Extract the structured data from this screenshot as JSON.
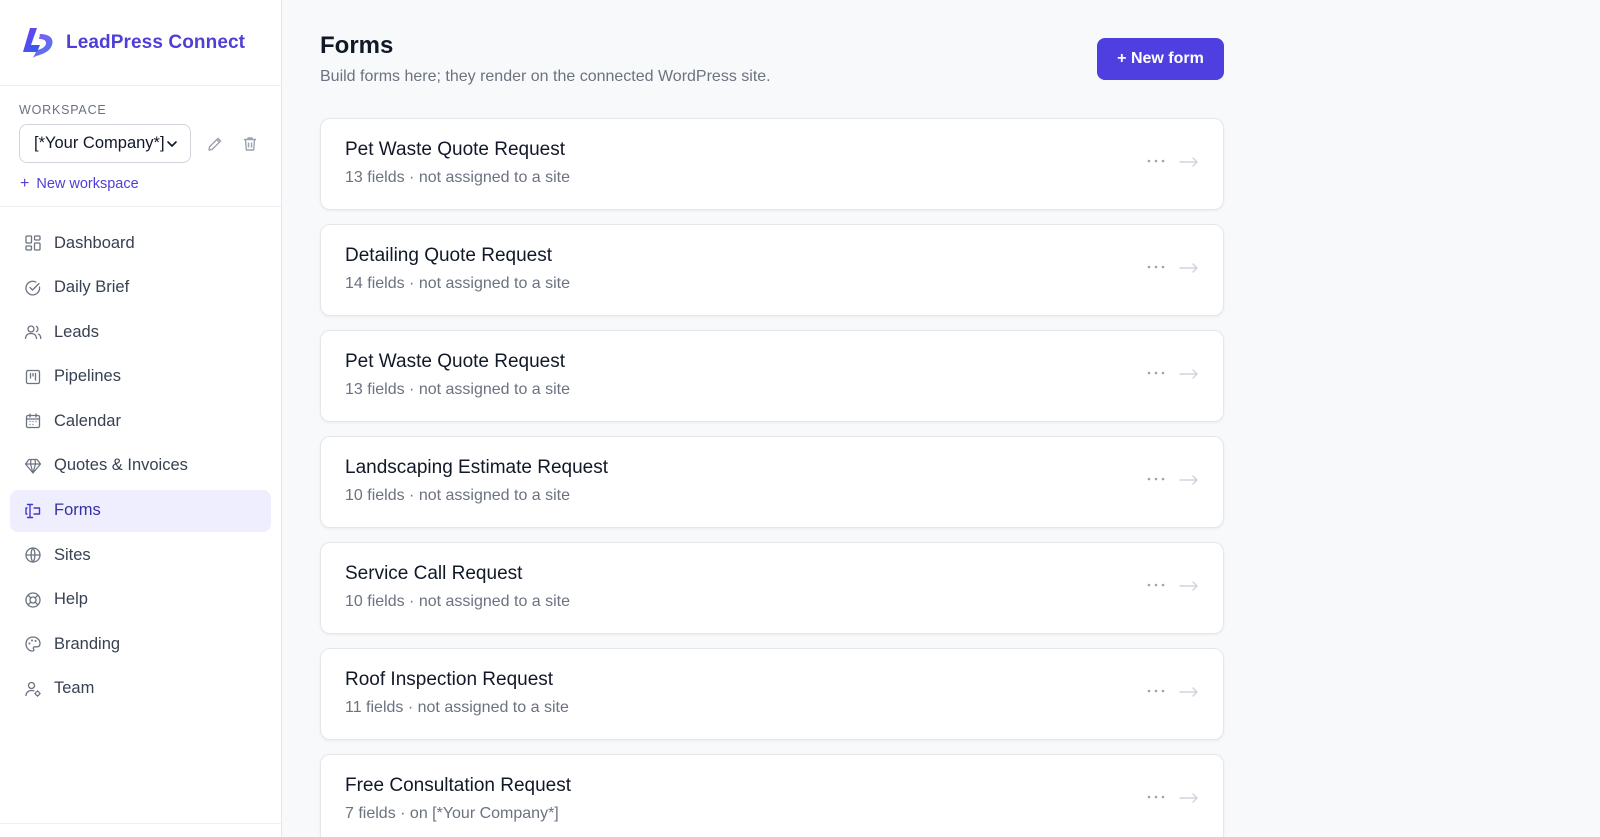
{
  "app": {
    "name": "LeadPress Connect"
  },
  "workspace": {
    "label": "WORKSPACE",
    "selected": "[*Your Company*]",
    "new_label": "New workspace"
  },
  "nav": [
    {
      "label": "Dashboard",
      "icon": "dashboard-icon"
    },
    {
      "label": "Daily Brief",
      "icon": "check-circle-icon"
    },
    {
      "label": "Leads",
      "icon": "users-icon"
    },
    {
      "label": "Pipelines",
      "icon": "kanban-icon"
    },
    {
      "label": "Calendar",
      "icon": "calendar-icon"
    },
    {
      "label": "Quotes & Invoices",
      "icon": "diamond-icon"
    },
    {
      "label": "Forms",
      "icon": "forms-icon",
      "active": true
    },
    {
      "label": "Sites",
      "icon": "globe-icon"
    },
    {
      "label": "Help",
      "icon": "lifebuoy-icon"
    },
    {
      "label": "Branding",
      "icon": "palette-icon"
    },
    {
      "label": "Team",
      "icon": "user-cog-icon"
    }
  ],
  "page": {
    "title": "Forms",
    "subtitle": "Build forms here; they render on the connected WordPress site.",
    "new_button": "+ New form"
  },
  "forms": [
    {
      "title": "Pet Waste Quote Request",
      "meta": "13 fields · not assigned to a site"
    },
    {
      "title": "Detailing Quote Request",
      "meta": "14 fields · not assigned to a site"
    },
    {
      "title": "Pet Waste Quote Request",
      "meta": "13 fields · not assigned to a site"
    },
    {
      "title": "Landscaping Estimate Request",
      "meta": "10 fields · not assigned to a site"
    },
    {
      "title": "Service Call Request",
      "meta": "10 fields · not assigned to a site"
    },
    {
      "title": "Roof Inspection Request",
      "meta": "11 fields · not assigned to a site"
    },
    {
      "title": "Free Consultation Request",
      "meta": "7 fields · on [*Your Company*]"
    }
  ],
  "colors": {
    "accent": "#4f3fe0",
    "active_bg": "#eeeefe",
    "text_muted": "#6b7280"
  }
}
